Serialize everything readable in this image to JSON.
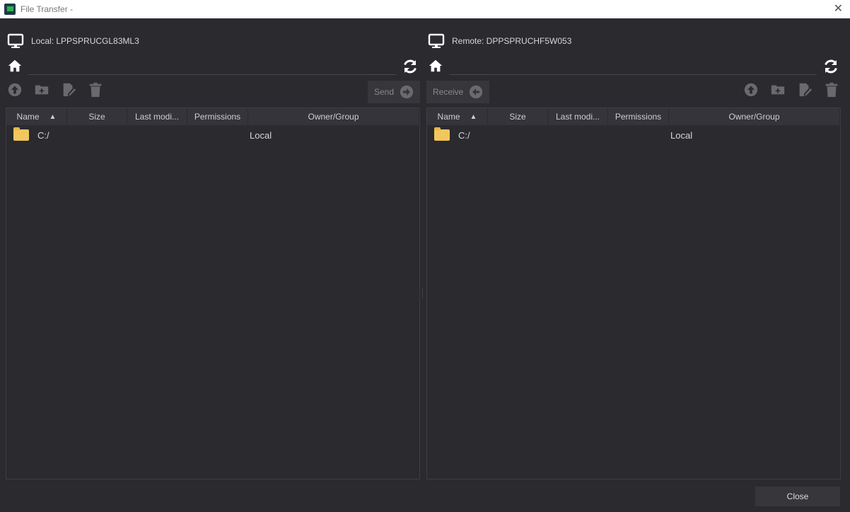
{
  "window": {
    "title": "File Transfer -"
  },
  "local": {
    "label": "Local: LPPSPRUCGL83ML3",
    "path": "",
    "transfer_label": "Send",
    "columns": [
      "Name",
      "Size",
      "Last modi...",
      "Permissions",
      "Owner/Group"
    ],
    "rows": [
      {
        "name": "C:/",
        "owner": "Local"
      }
    ]
  },
  "remote": {
    "label": "Remote: DPPSPRUCHF5W053",
    "path": "",
    "transfer_label": "Receive",
    "columns": [
      "Name",
      "Size",
      "Last modi...",
      "Permissions",
      "Owner/Group"
    ],
    "rows": [
      {
        "name": "C:/",
        "owner": "Local"
      }
    ]
  },
  "footer": {
    "close_label": "Close"
  }
}
